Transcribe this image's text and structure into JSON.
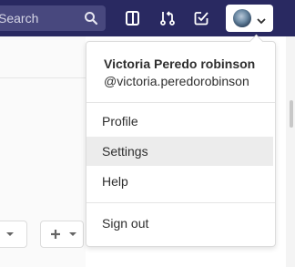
{
  "search": {
    "placeholder": "Search"
  },
  "user_menu": {
    "name": "Victoria Peredo robinson",
    "handle": "@victoria.peredorobinson",
    "items": [
      {
        "label": "Profile"
      },
      {
        "label": "Settings",
        "highlighted": true
      },
      {
        "label": "Help"
      }
    ],
    "sign_out": "Sign out"
  },
  "colors": {
    "topbar": "#292961",
    "search_bg": "#48487e",
    "highlight": "#ececec"
  }
}
